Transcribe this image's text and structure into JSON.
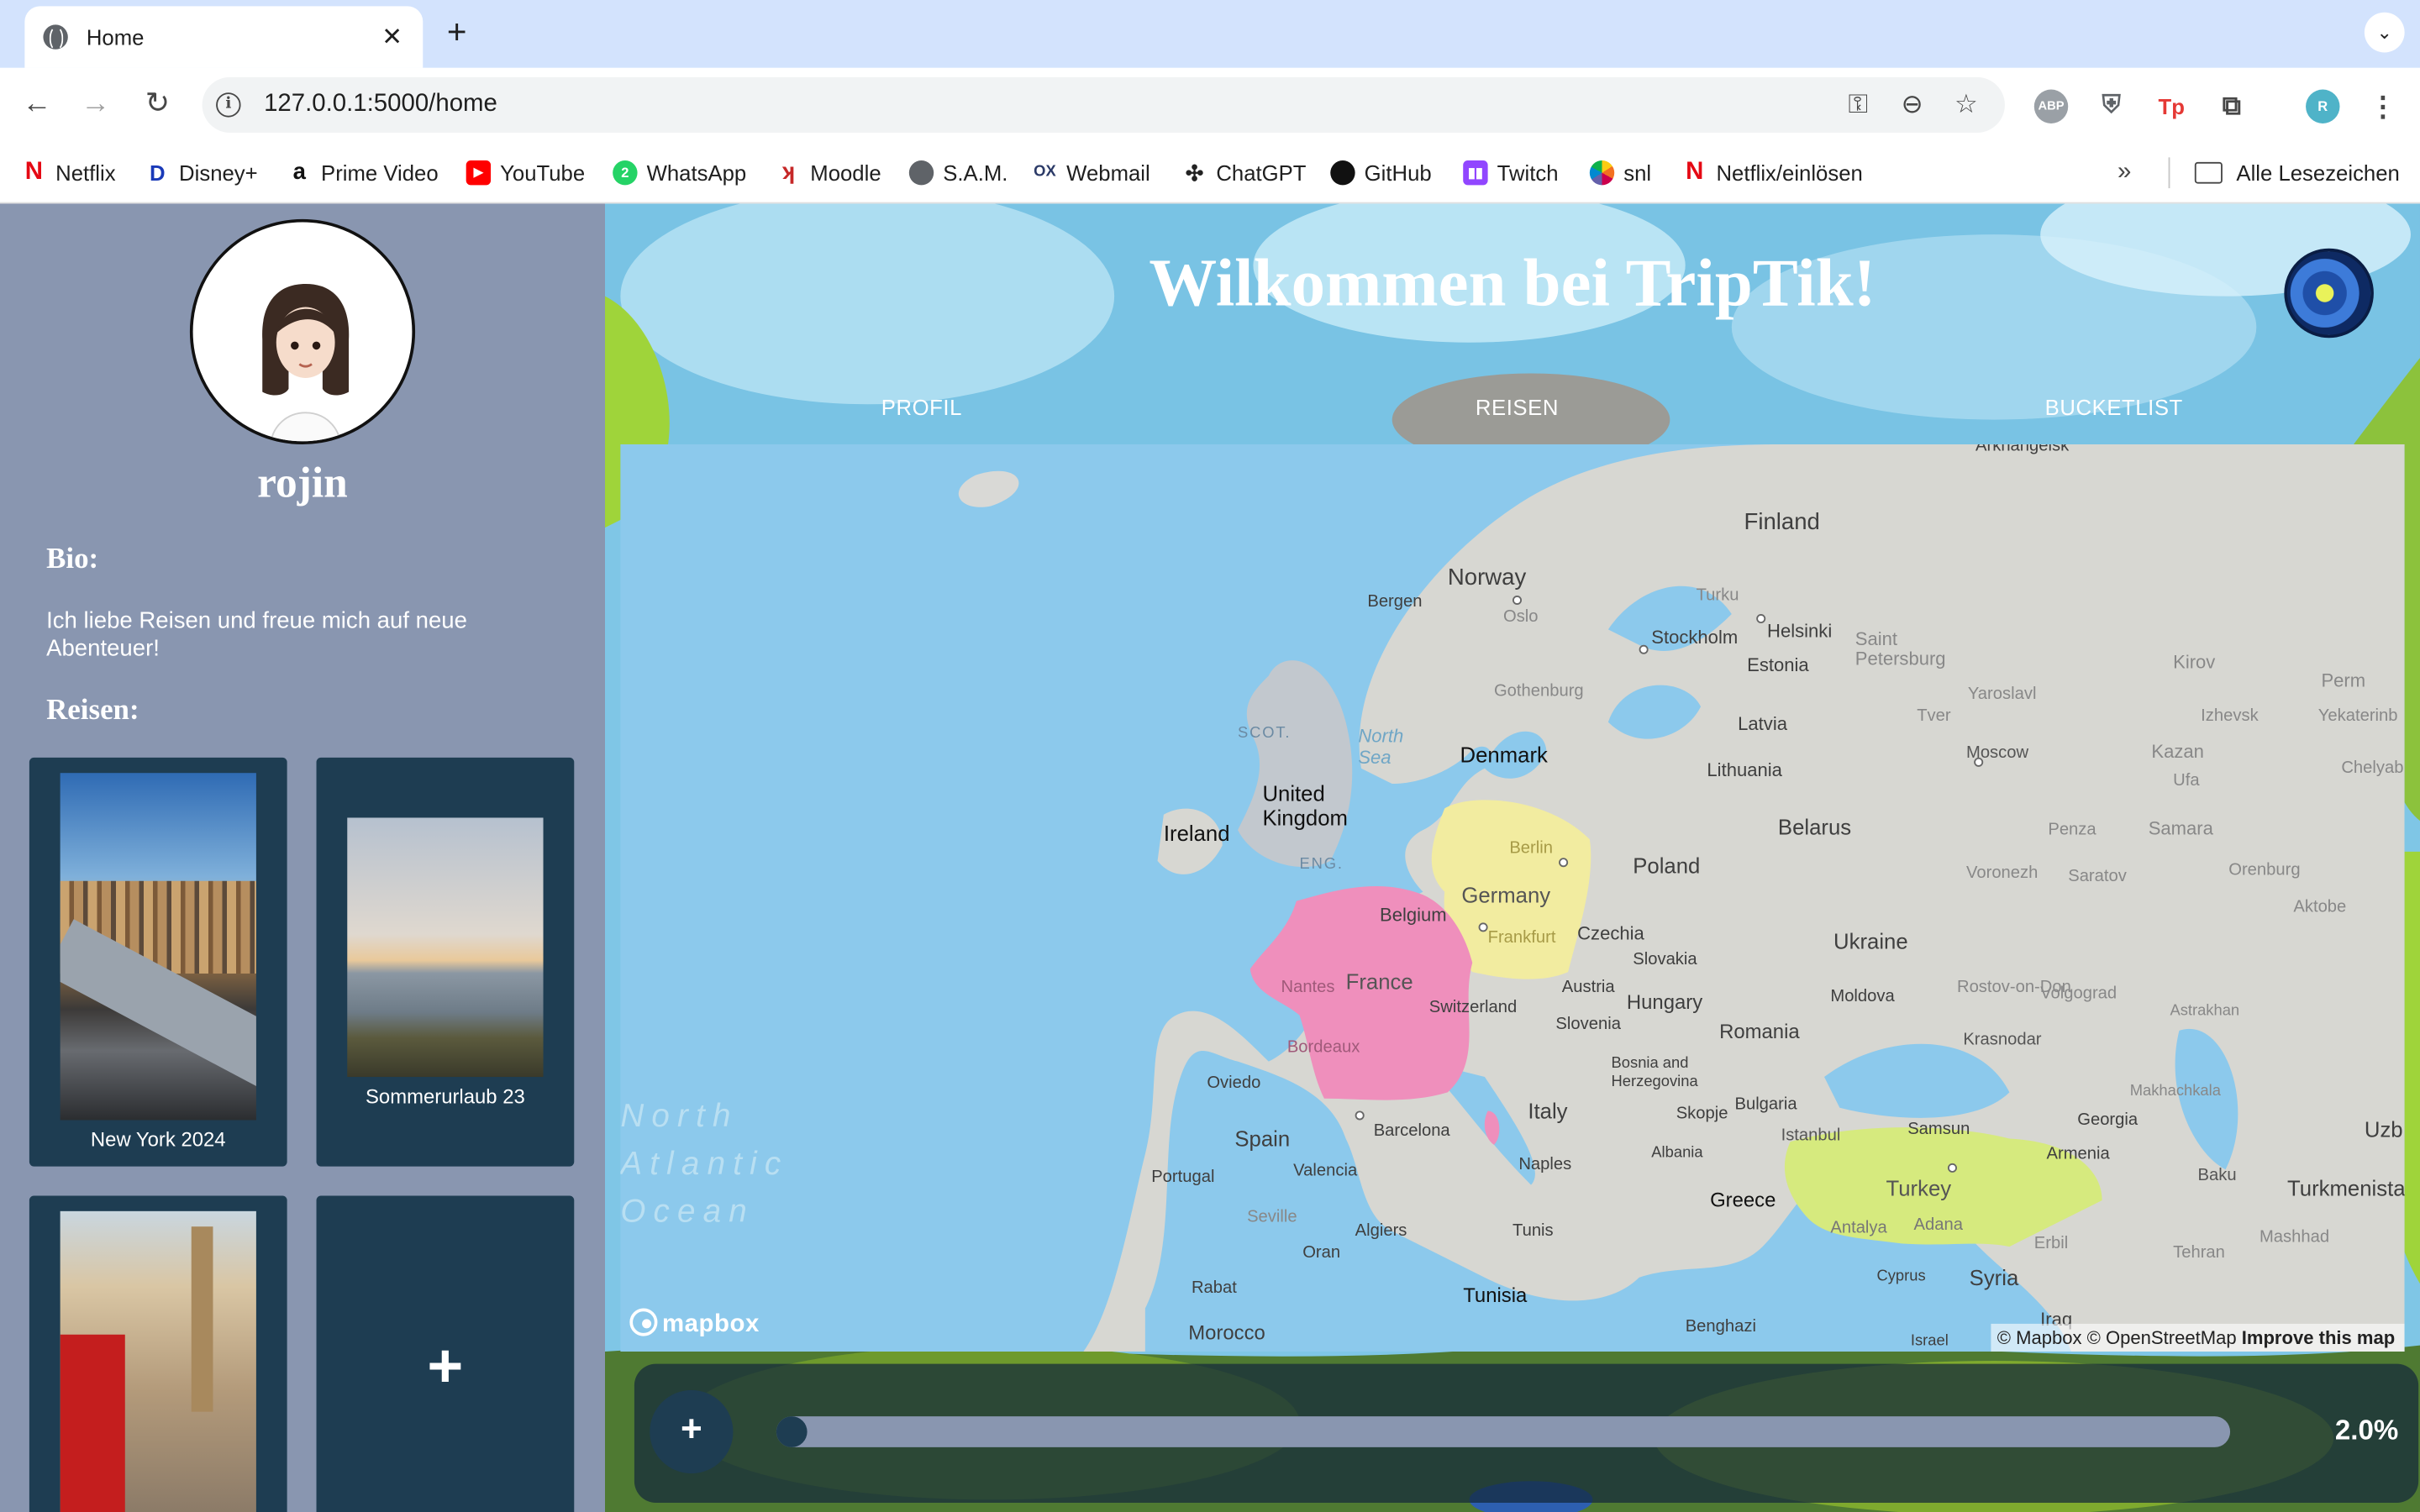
{
  "browser": {
    "tab_title": "Home",
    "url": "127.0.0.1:5000/home",
    "bookmarks": [
      "Netflix",
      "Disney+",
      "Prime Video",
      "YouTube",
      "WhatsApp",
      "Moodle",
      "S.A.M.",
      "Webmail",
      "ChatGPT",
      "GitHub",
      "Twitch",
      "snl",
      "Netflix/einlösen"
    ],
    "all_bookmarks": "Alle Lesezeichen",
    "more": "»"
  },
  "sidebar": {
    "username": "rojin",
    "bio_heading": "Bio:",
    "bio": "Ich liebe Reisen und freue mich auf neue Abenteuer!",
    "trips_heading": "Reisen:",
    "trips": [
      {
        "label": "New York 2024"
      },
      {
        "label": "Sommerurlaub 23"
      },
      {
        "label": ""
      }
    ],
    "add_label": "+"
  },
  "header": {
    "title": "Wilkommen bei TripTik!",
    "nav": [
      "PROFIL",
      "REISEN",
      "BUCKETLIST"
    ]
  },
  "map": {
    "visited_countries": [
      "France",
      "Germany",
      "Turkey"
    ],
    "labels": {
      "finland": "Finland",
      "norway": "Norway",
      "bergen": "Bergen",
      "oslo": "Oslo",
      "turku": "Turku",
      "stockholm": "Stockholm",
      "helsinki": "Helsinki",
      "stpetersburg": "Saint\nPetersburg",
      "estonia": "Estonia",
      "kirov": "Kirov",
      "perm": "Perm",
      "gothenburg": "Gothenburg",
      "latvia": "Latvia",
      "yaroslavl": "Yaroslavl",
      "izhevsk": "Izhevsk",
      "yekaterinburg": "Yekaterinb",
      "scot": "SCOT.",
      "northsea": "North\nSea",
      "denmark": "Denmark",
      "tver": "Tver",
      "moscow": "Moscow",
      "kazan": "Kazan",
      "chelyabinsk": "Chelyab",
      "lithuania": "Lithuania",
      "uk": "United\nKingdom",
      "ireland": "Ireland",
      "eng": "ENG.",
      "berlin": "Berlin",
      "belarus": "Belarus",
      "poland": "Poland",
      "ufa": "Ufa",
      "samara": "Samara",
      "penza": "Penza",
      "germany": "Germany",
      "voronezh": "Voronezh",
      "saratov": "Saratov",
      "orenburg": "Orenburg",
      "belgium": "Belgium",
      "frankfurt": "Frankfurt",
      "czechia": "Czechia",
      "ukraine": "Ukraine",
      "aktobe": "Aktobe",
      "france": "France",
      "nantes": "Nantes",
      "slovakia": "Slovakia",
      "volgograd": "Volgograd",
      "austria": "Austria",
      "rostov": "Rostov-on-Don",
      "hungary": "Hungary",
      "moldova": "Moldova",
      "switzerland": "Switzerland",
      "astrakhan": "Astrakhan",
      "slovenia": "Slovenia",
      "romania": "Romania",
      "krasnodar": "Krasnodar",
      "bordeaux": "Bordeaux",
      "oviedo": "Oviedo",
      "bosnia": "Bosnia and\nHerzegovina",
      "makhachkala": "Makhachkala",
      "northatlantic": "North\nAtlantic\nOcean",
      "italy": "Italy",
      "bulgaria": "Bulgaria",
      "georgia": "Georgia",
      "spain": "Spain",
      "barcelona": "Barcelona",
      "skopje": "Skopje",
      "istanbul": "Istanbul",
      "samsun": "Samsun",
      "armenia": "Armenia",
      "uzb": "Uzb",
      "portugal": "Portugal",
      "valencia": "Valencia",
      "naples": "Naples",
      "albania": "Albania",
      "baku": "Baku",
      "turkmenistan": "Turkmenista",
      "turkey": "Turkey",
      "greece": "Greece",
      "seville": "Seville",
      "algiers": "Algiers",
      "tunis": "Tunis",
      "antalya": "Antalya",
      "adana": "Adana",
      "erbil": "Erbil",
      "mashhad": "Mashhad",
      "oran": "Oran",
      "tehran": "Tehran",
      "rabat": "Rabat",
      "cyprus": "Cyprus",
      "syria": "Syria",
      "tunisia": "Tunisia",
      "iraq": "Iraq",
      "morocco": "Morocco",
      "benghazi": "Benghazi",
      "israel": "Israel",
      "arkhangelsk": "Arkhangelsk"
    },
    "brand": "mapbox",
    "attribution": "© Mapbox © OpenStreetMap",
    "improve": "Improve this map"
  },
  "progress": {
    "add_label": "+",
    "value": 0.02,
    "label": "2.0%"
  }
}
